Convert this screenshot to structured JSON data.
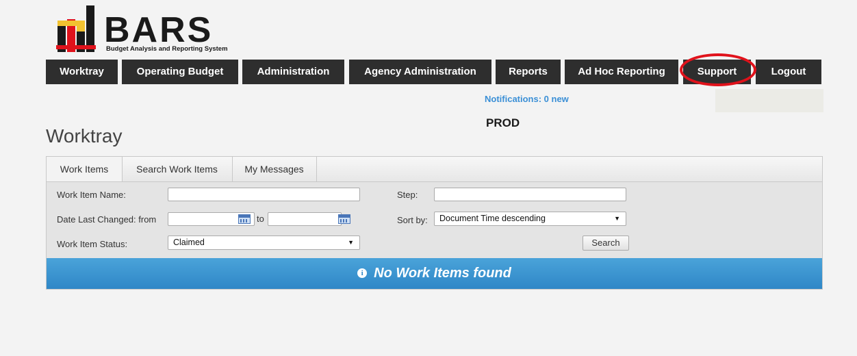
{
  "logo": {
    "text": "BARS",
    "subtitle": "Budget Analysis and Reporting System"
  },
  "nav": [
    {
      "label": "Worktray"
    },
    {
      "label": "Operating Budget"
    },
    {
      "label": "Administration"
    },
    {
      "label": "Agency Administration"
    },
    {
      "label": "Reports"
    },
    {
      "label": "Ad Hoc Reporting"
    },
    {
      "label": "Support"
    },
    {
      "label": "Logout"
    }
  ],
  "header": {
    "notifications": "Notifications: 0 new",
    "environment": "PROD"
  },
  "page": {
    "title": "Worktray"
  },
  "tabs": [
    {
      "label": "Work Items"
    },
    {
      "label": "Search Work Items"
    },
    {
      "label": "My Messages"
    }
  ],
  "form": {
    "work_item_name_label": "Work Item Name:",
    "work_item_name_value": "",
    "date_label": "Date Last Changed: from",
    "date_from_value": "",
    "to_label": "to",
    "date_to_value": "",
    "status_label": "Work Item Status:",
    "status_value": "Claimed",
    "step_label": "Step:",
    "step_value": "",
    "sort_label": "Sort by:",
    "sort_value": "Document Time descending",
    "search_button": "Search"
  },
  "result": {
    "message": "No Work Items found",
    "icon": "info-icon"
  },
  "colors": {
    "nav_bg": "#2e2e2e",
    "banner": "#3594cf",
    "highlight": "#e0121b",
    "link": "#3a8fd6"
  }
}
